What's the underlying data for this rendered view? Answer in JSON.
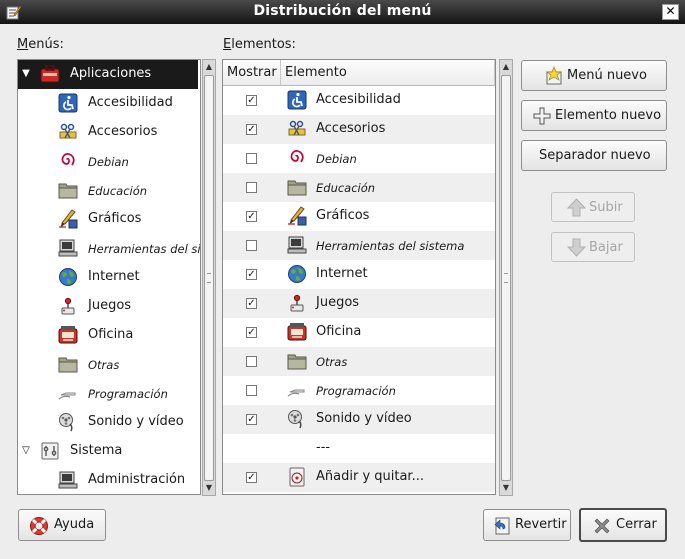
{
  "window": {
    "title": "Distribución del menú",
    "close_glyph": "✕"
  },
  "menus_label": "Menús:",
  "items_label": "Elementos:",
  "tree": [
    {
      "label": "Aplicaciones",
      "icon": "toolbox-icon",
      "level": 0,
      "expander": "expanded",
      "italic": false,
      "selected": true
    },
    {
      "label": "Accesibilidad",
      "icon": "accessibility-icon",
      "level": 1,
      "italic": false
    },
    {
      "label": "Accesorios",
      "icon": "accessories-icon",
      "level": 1,
      "italic": false
    },
    {
      "label": "Debian",
      "icon": "debian-swirl-icon",
      "level": 1,
      "italic": true
    },
    {
      "label": "Educación",
      "icon": "folder-icon",
      "level": 1,
      "italic": true
    },
    {
      "label": "Gráficos",
      "icon": "graphics-icon",
      "level": 1,
      "italic": false
    },
    {
      "label": "Herramientas del sistema",
      "icon": "computer-icon",
      "level": 1,
      "italic": true
    },
    {
      "label": "Internet",
      "icon": "globe-icon",
      "level": 1,
      "italic": false
    },
    {
      "label": "Juegos",
      "icon": "joystick-icon",
      "level": 1,
      "italic": false
    },
    {
      "label": "Oficina",
      "icon": "office-icon",
      "level": 1,
      "italic": false
    },
    {
      "label": "Otras",
      "icon": "folder-icon",
      "level": 1,
      "italic": true
    },
    {
      "label": "Programación",
      "icon": "programming-icon",
      "level": 1,
      "italic": true
    },
    {
      "label": "Sonido y vídeo",
      "icon": "multimedia-icon",
      "level": 1,
      "italic": false
    },
    {
      "label": "Sistema",
      "icon": "system-icon",
      "level": 0,
      "expander": "expanded",
      "italic": false
    },
    {
      "label": "Administración",
      "icon": "computer-icon",
      "level": 1,
      "italic": false
    }
  ],
  "columns": {
    "show": "Mostrar",
    "item": "Elemento"
  },
  "items": [
    {
      "label": "Accesibilidad",
      "icon": "accessibility-icon",
      "checked": true,
      "italic": false
    },
    {
      "label": "Accesorios",
      "icon": "accessories-icon",
      "checked": true,
      "italic": false
    },
    {
      "label": "Debian",
      "icon": "debian-swirl-icon",
      "checked": false,
      "italic": true
    },
    {
      "label": "Educación",
      "icon": "folder-icon",
      "checked": false,
      "italic": true
    },
    {
      "label": "Gráficos",
      "icon": "graphics-icon",
      "checked": true,
      "italic": false
    },
    {
      "label": "Herramientas del sistema",
      "icon": "computer-icon",
      "checked": false,
      "italic": true
    },
    {
      "label": "Internet",
      "icon": "globe-icon",
      "checked": true,
      "italic": false
    },
    {
      "label": "Juegos",
      "icon": "joystick-icon",
      "checked": true,
      "italic": false
    },
    {
      "label": "Oficina",
      "icon": "office-icon",
      "checked": true,
      "italic": false
    },
    {
      "label": "Otras",
      "icon": "folder-icon",
      "checked": false,
      "italic": true
    },
    {
      "label": "Programación",
      "icon": "programming-icon",
      "checked": false,
      "italic": true
    },
    {
      "label": "Sonido y vídeo",
      "icon": "multimedia-icon",
      "checked": true,
      "italic": false
    },
    {
      "label": "---",
      "icon": "",
      "checked": null,
      "italic": false,
      "separator": true
    },
    {
      "label": "Añadir y quitar...",
      "icon": "add-remove-icon",
      "checked": true,
      "italic": false
    }
  ],
  "buttons": {
    "new_menu": "Menú nuevo",
    "new_item": "Elemento nuevo",
    "new_separator": "Separador nuevo",
    "move_up": "Subir",
    "move_down": "Bajar",
    "help": "Ayuda",
    "revert": "Revertir",
    "close": "Cerrar"
  },
  "colors": {
    "selection": "#1a1a1a",
    "titlebar": "#2a2a2a",
    "window_bg": "#ededed",
    "alt_row": "#efefef"
  }
}
